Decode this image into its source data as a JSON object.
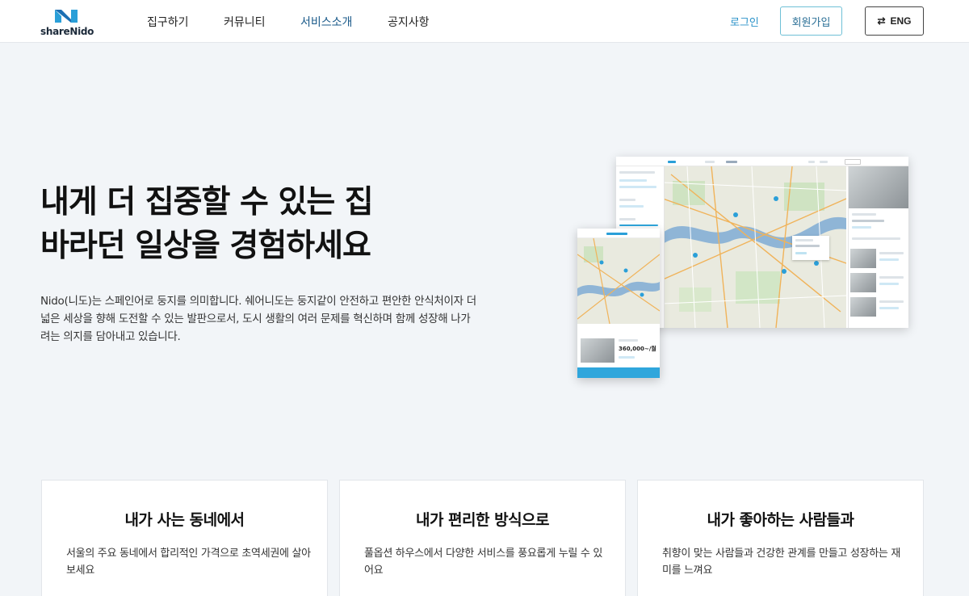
{
  "header": {
    "logo_text": "shareNido",
    "nav": [
      {
        "label": "집구하기"
      },
      {
        "label": "커뮤니티"
      },
      {
        "label": "서비스소개"
      },
      {
        "label": "공지사항"
      }
    ],
    "login_label": "로그인",
    "signup_label": "회원가입",
    "lang_label": "ENG",
    "brand_color": "#2a92c9"
  },
  "hero": {
    "title_line1": "내게 더 집중할 수 있는 집",
    "title_line2": "바라던 일상을 경험하세요",
    "description": "Nido(니도)는 스페인어로 둥지를 의미합니다. 쉐어니도는 둥지같이 안전하고 편안한 안식처이자 더 넓은 세상을 향해 도전할 수 있는 발판으로서, 도시 생활의 여러 문제를 혁신하며 함께 성장해 나가려는 의지를 담아내고 있습니다.",
    "mobile_mockup_price": "360,000~/월"
  },
  "features": [
    {
      "title": "내가 사는 동네에서",
      "description": "서울의 주요 동네에서 합리적인 가격으로 초역세권에 살아보세요"
    },
    {
      "title": "내가 편리한 방식으로",
      "description": "풀옵션 하우스에서 다양한 서비스를 풍요롭게 누릴 수 있어요"
    },
    {
      "title": "내가 좋아하는 사람들과",
      "description": "취향이 맞는 사람들과 건강한 관계를 만들고 성장하는 재미를 느껴요"
    }
  ]
}
